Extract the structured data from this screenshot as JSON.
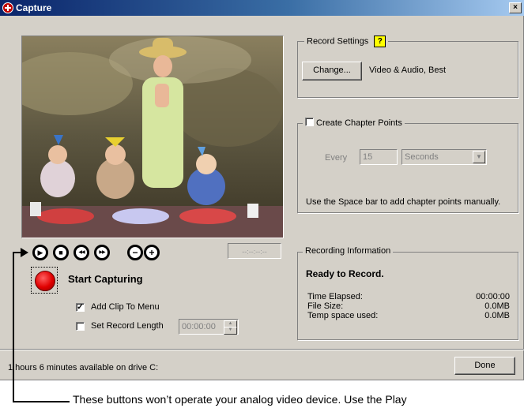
{
  "window": {
    "title": "Capture",
    "close_label": "×"
  },
  "transport": {
    "buttons": [
      {
        "name": "play-icon",
        "glyph": "▶"
      },
      {
        "name": "stop-icon",
        "glyph": "■"
      },
      {
        "name": "rewind-icon",
        "glyph": "◀◀"
      },
      {
        "name": "fast-forward-icon",
        "glyph": "▶▶"
      },
      {
        "name": "minus-icon",
        "glyph": "−"
      },
      {
        "name": "plus-icon",
        "glyph": "+"
      }
    ],
    "timecode": "--:--:--:--"
  },
  "capture": {
    "start_label": "Start Capturing",
    "add_clip_label": "Add Clip To Menu",
    "add_clip_checked": true,
    "set_length_label": "Set Record Length",
    "set_length_checked": false,
    "length_value": "00:00:00"
  },
  "record_settings": {
    "title": "Record Settings",
    "help_label": "?",
    "change_label": "Change...",
    "value": "Video & Audio, Best"
  },
  "chapter_points": {
    "title": "Create Chapter Points",
    "checked": false,
    "every_label": "Every",
    "every_value": "15",
    "unit": "Seconds",
    "hint": "Use the Space bar to add chapter points manually."
  },
  "recording_info": {
    "title": "Recording Information",
    "status": "Ready to Record.",
    "rows": [
      {
        "label": "Time Elapsed:",
        "value": "00:00:00"
      },
      {
        "label": "File Size:",
        "value": "0.0MB"
      },
      {
        "label": "Temp space used:",
        "value": "0.0MB"
      }
    ]
  },
  "footer": {
    "drive_text": "1 hours 6 minutes available on drive C:",
    "done_label": "Done"
  },
  "callout": {
    "text": "These buttons won’t operate your analog video device. Use the Play"
  }
}
